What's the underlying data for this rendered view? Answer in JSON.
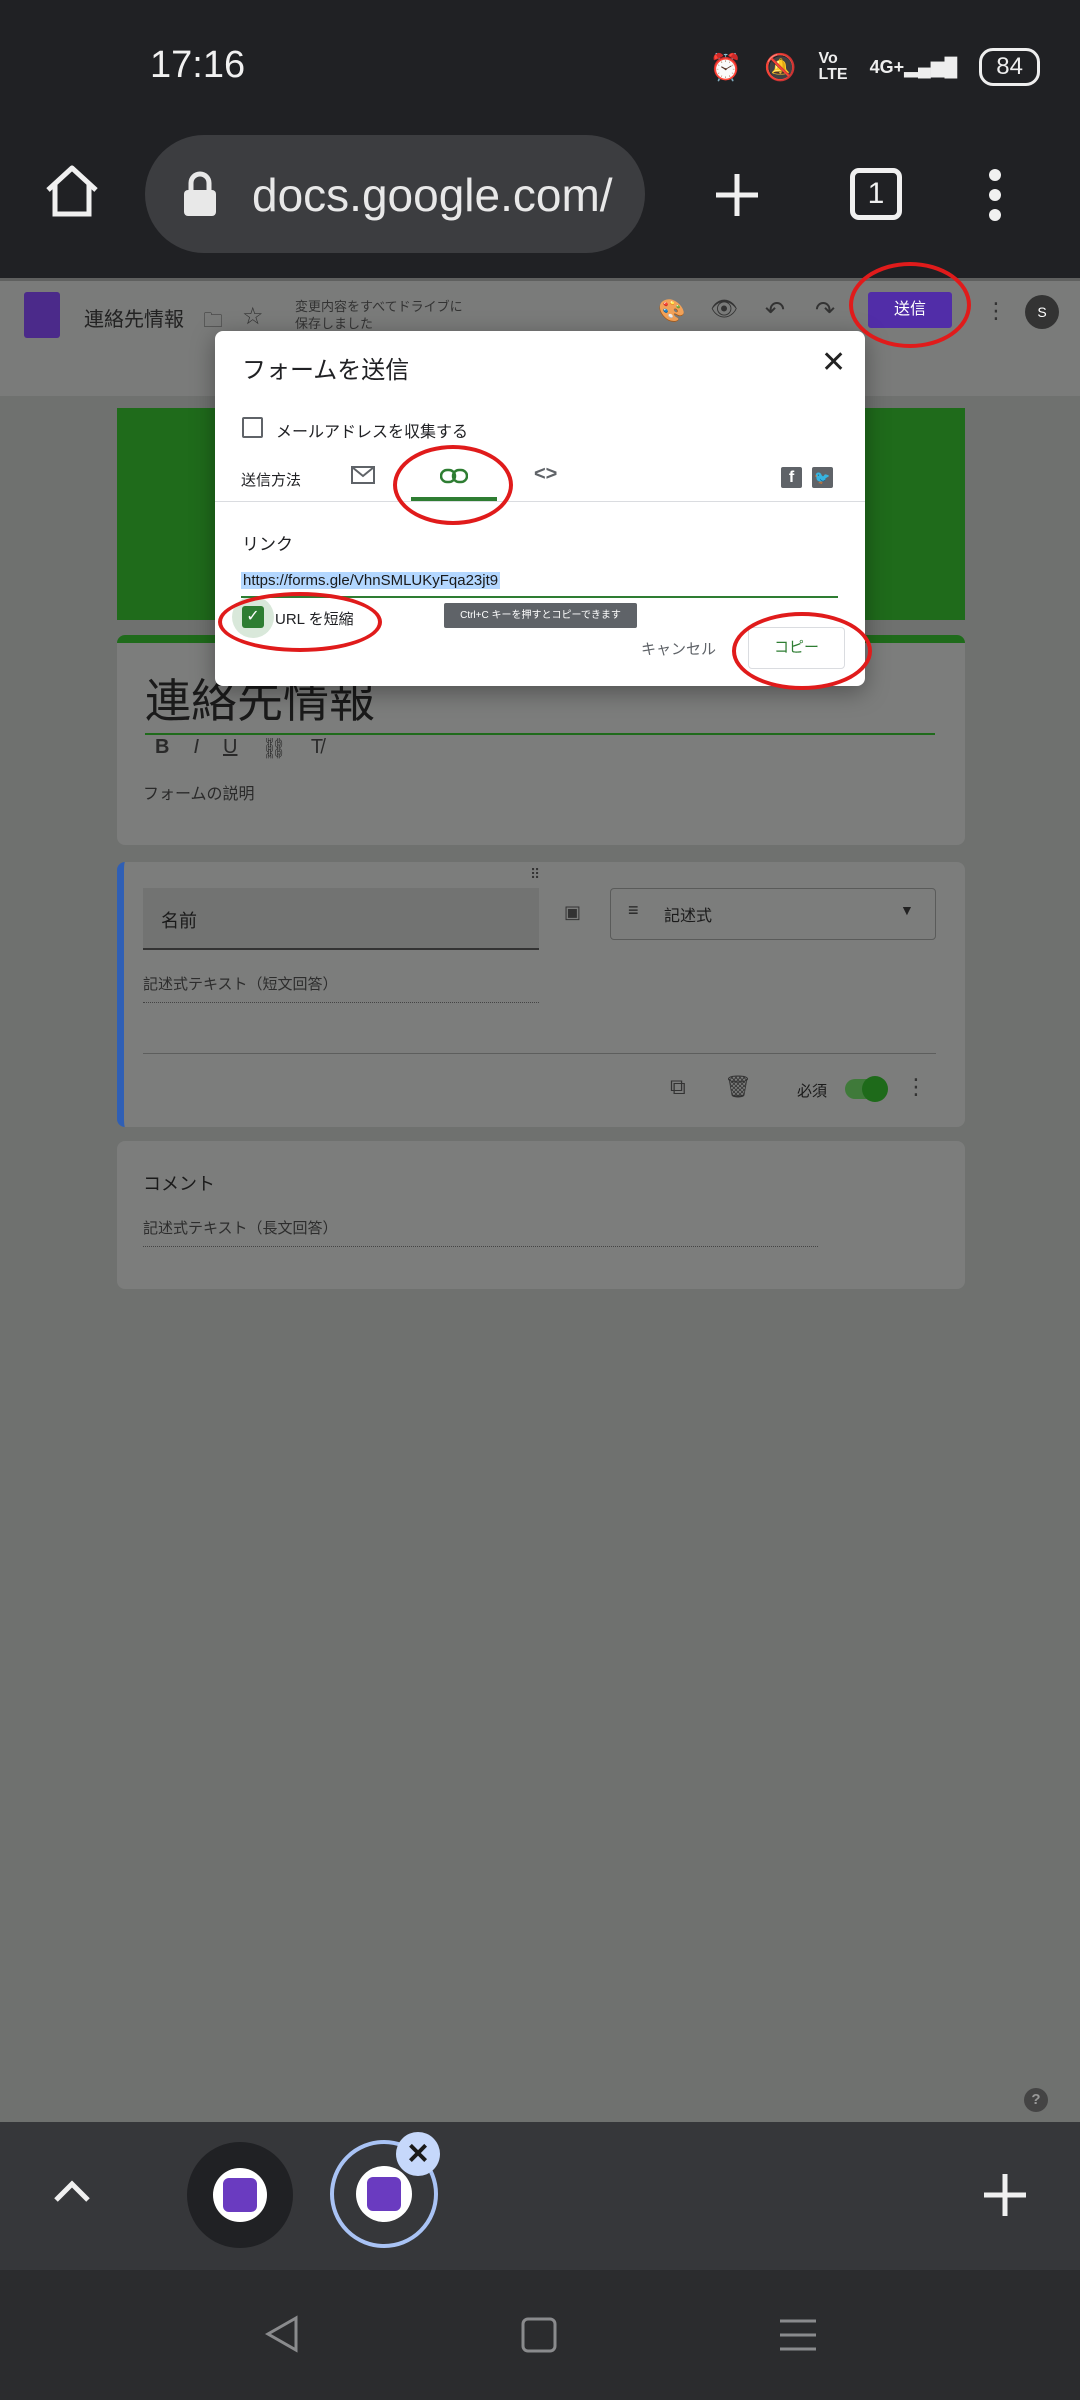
{
  "status_bar": {
    "time": "17:16",
    "battery": "84"
  },
  "browser": {
    "url": "docs.google.com/",
    "tab_count": "1"
  },
  "forms_header": {
    "title": "連絡先情報",
    "autosave_line1": "変更内容をすべてドライブに",
    "autosave_line2": "保存しました",
    "send_label": "送信",
    "avatar": "S"
  },
  "form": {
    "title": "連絡先情報",
    "description": "フォームの説明",
    "question1": {
      "title": "名前",
      "type": "記述式",
      "answer_placeholder": "記述式テキスト（短文回答）",
      "required_label": "必須"
    },
    "question2": {
      "title": "コメント",
      "answer_placeholder": "記述式テキスト（長文回答）"
    }
  },
  "dialog": {
    "title": "フォームを送信",
    "collect_email": "メールアドレスを収集する",
    "send_method": "送信方法",
    "link_label": "リンク",
    "link_url": "https://forms.gle/VhnSMLUKyFqa23jt9",
    "shorten_url": "URL を短縮",
    "tooltip": "Ctrl+C キーを押すとコピーできます",
    "cancel": "キャンセル",
    "copy": "コピー"
  },
  "colors": {
    "forms_purple": "#512da8",
    "forms_green": "#2e7d32",
    "annotation_red": "#e01b1b"
  }
}
